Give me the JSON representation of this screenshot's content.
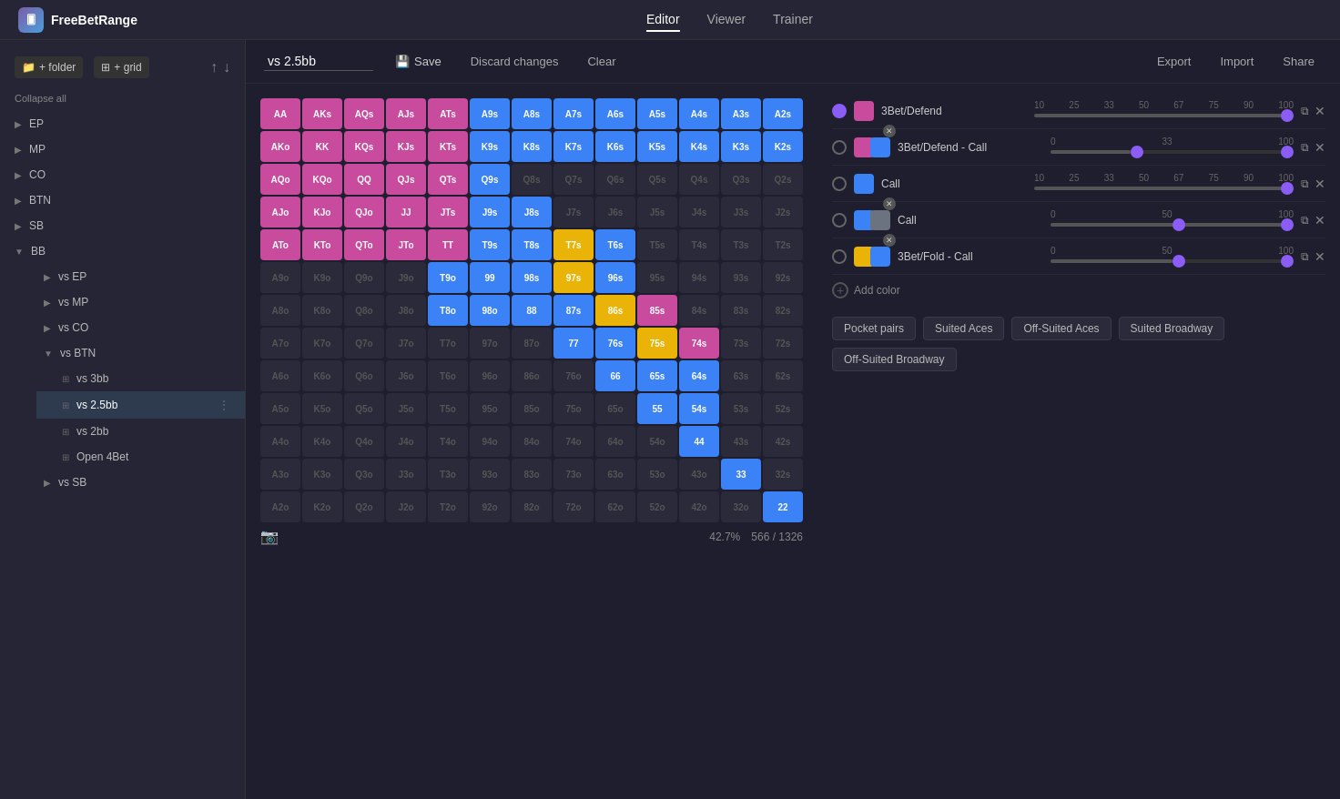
{
  "app": {
    "name": "FreeBetRange",
    "nav_tabs": [
      "Editor",
      "Viewer",
      "Trainer"
    ],
    "active_tab": "Editor"
  },
  "toolbar": {
    "range_name": "vs 2.5bb",
    "save_label": "Save",
    "discard_label": "Discard changes",
    "clear_label": "Clear",
    "export_label": "Export",
    "import_label": "Import",
    "share_label": "Share"
  },
  "sidebar": {
    "collapse_label": "Collapse all",
    "new_folder_label": "+ folder",
    "new_grid_label": "+ grid",
    "items": [
      {
        "id": "ep",
        "label": "EP",
        "expanded": false
      },
      {
        "id": "mp",
        "label": "MP",
        "expanded": false
      },
      {
        "id": "co",
        "label": "CO",
        "expanded": false
      },
      {
        "id": "btn",
        "label": "BTN",
        "expanded": false
      },
      {
        "id": "sb",
        "label": "SB",
        "expanded": false
      },
      {
        "id": "bb",
        "label": "BB",
        "expanded": true,
        "children": [
          {
            "id": "vs-ep",
            "label": "vs EP"
          },
          {
            "id": "vs-mp",
            "label": "vs MP"
          },
          {
            "id": "vs-co",
            "label": "vs CO"
          },
          {
            "id": "vs-btn",
            "label": "vs BTN",
            "expanded": true,
            "children": [
              {
                "id": "vs-3bb",
                "label": "vs 3bb"
              },
              {
                "id": "vs-2.5bb",
                "label": "vs 2.5bb",
                "active": true
              },
              {
                "id": "vs-2bb",
                "label": "vs 2bb"
              },
              {
                "id": "open-4bet",
                "label": "Open 4Bet"
              }
            ]
          },
          {
            "id": "vs-sb",
            "label": "vs SB"
          }
        ]
      }
    ]
  },
  "grid": {
    "stats": {
      "percentage": "42.7%",
      "fraction": "566 / 1326"
    }
  },
  "colors": [
    {
      "id": "c1",
      "label": "3Bet/Defend",
      "color": "#c84b9e",
      "secondary": null,
      "selected": true,
      "slider_marks": [
        10,
        25,
        33,
        50,
        67,
        75,
        90,
        100
      ],
      "slider_value": 100,
      "slider_start": 0
    },
    {
      "id": "c2",
      "label": "3Bet/Defend - Call",
      "color": "#c84b9e",
      "secondary": "#3b82f6",
      "selected": false,
      "slider_marks": [
        0,
        33,
        100
      ],
      "slider_value": 33,
      "slider_end": 100
    },
    {
      "id": "c3",
      "label": "Call",
      "color": "#3b82f6",
      "secondary": null,
      "selected": false,
      "slider_marks": [
        10,
        25,
        33,
        50,
        67,
        75,
        90,
        100
      ],
      "slider_value": 100,
      "slider_start": 0
    },
    {
      "id": "c4",
      "label": "Call",
      "color": "#3b82f6",
      "secondary": "#6b7280",
      "selected": false,
      "slider_marks": [
        0,
        50,
        100
      ],
      "slider_value": 100,
      "slider_mid": 50
    },
    {
      "id": "c5",
      "label": "3Bet/Fold - Call",
      "color": "#eab308",
      "secondary": "#3b82f6",
      "selected": false,
      "slider_marks": [
        0,
        50,
        100
      ],
      "slider_value": 50,
      "slider_end": 100
    }
  ],
  "quick_select": [
    "Pocket pairs",
    "Suited Aces",
    "Off-Suited Aces",
    "Suited Broadway",
    "Off-Suited Broadway"
  ]
}
